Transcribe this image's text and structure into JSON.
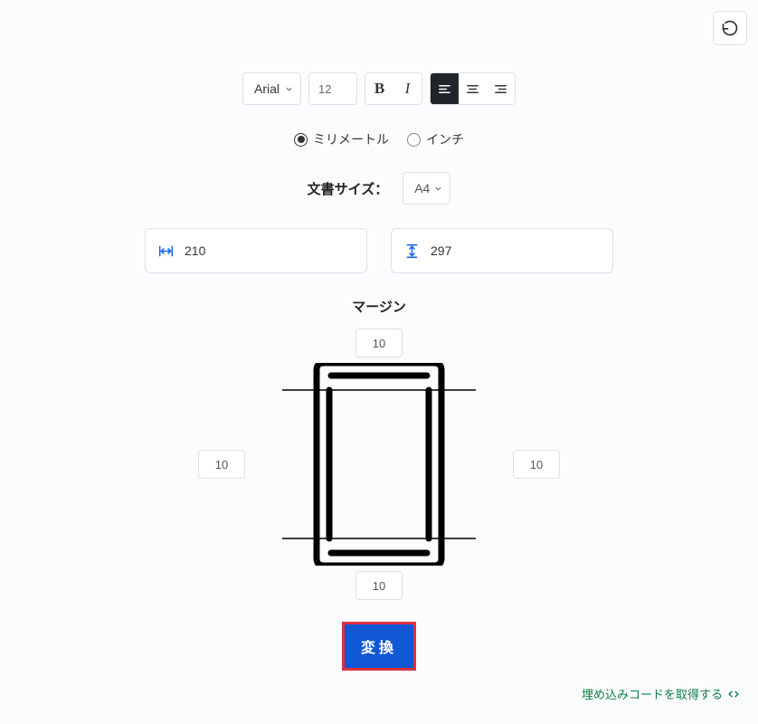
{
  "toolbar": {
    "font_name": "Arial",
    "font_size": "12"
  },
  "units": {
    "mm_label": "ミリメートル",
    "inch_label": "インチ",
    "selected": "mm"
  },
  "document": {
    "size_label": "文書サイズ：",
    "size_value": "A4",
    "width": "210",
    "height": "297"
  },
  "margins": {
    "title": "マージン",
    "top": "10",
    "right": "10",
    "bottom": "10",
    "left": "10"
  },
  "actions": {
    "convert_label": "変換",
    "embed_label": "埋め込みコードを取得する"
  }
}
